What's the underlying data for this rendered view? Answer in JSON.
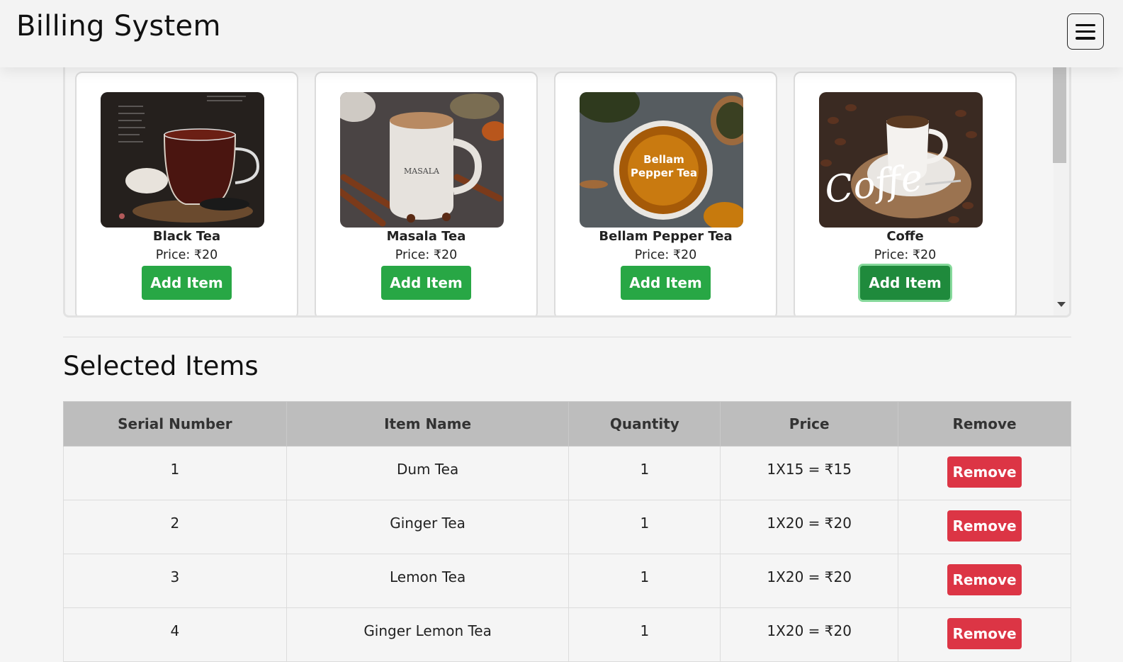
{
  "app": {
    "title": "Billing System",
    "menu_icon": "hamburger-menu-icon"
  },
  "products": [
    {
      "name": "Black Tea",
      "price": "Price: ₹20",
      "button": "Add Item"
    },
    {
      "name": "Masala Tea",
      "price": "Price: ₹20",
      "button": "Add Item"
    },
    {
      "name": "Bellam Pepper Tea",
      "price": "Price: ₹20",
      "button": "Add Item",
      "image_text": "Bellam Pepper Tea"
    },
    {
      "name": "Coffe",
      "price": "Price: ₹20",
      "button": "Add Item",
      "image_text": "Coffe"
    }
  ],
  "selected": {
    "title": "Selected Items",
    "headers": [
      "Serial Number",
      "Item Name",
      "Quantity",
      "Price",
      "Remove"
    ],
    "rows": [
      {
        "serial": "1",
        "item": "Dum Tea",
        "qty": "1",
        "price": "1X15 = ₹15",
        "action": "Remove"
      },
      {
        "serial": "2",
        "item": "Ginger Tea",
        "qty": "1",
        "price": "1X20 = ₹20",
        "action": "Remove"
      },
      {
        "serial": "3",
        "item": "Lemon Tea",
        "qty": "1",
        "price": "1X20 = ₹20",
        "action": "Remove"
      },
      {
        "serial": "4",
        "item": "Ginger Lemon Tea",
        "qty": "1",
        "price": "1X20 = ₹20",
        "action": "Remove"
      }
    ]
  },
  "colors": {
    "add": "#28a745",
    "remove": "#dc3545",
    "header": "#bdbdbd"
  }
}
